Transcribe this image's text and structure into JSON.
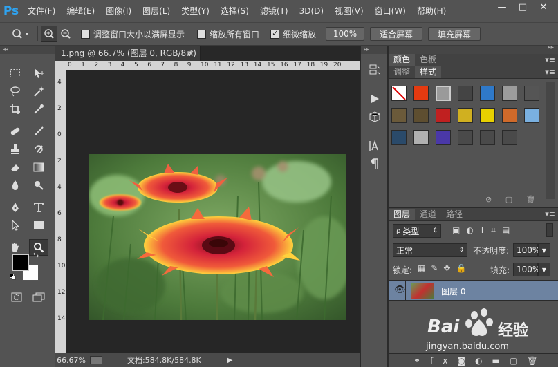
{
  "app": {
    "logo": "Ps"
  },
  "menu": [
    "文件(F)",
    "编辑(E)",
    "图像(I)",
    "图层(L)",
    "类型(Y)",
    "选择(S)",
    "滤镜(T)",
    "3D(D)",
    "视图(V)",
    "窗口(W)",
    "帮助(H)"
  ],
  "window_controls": {
    "minimize": "—",
    "maximize": "□",
    "close": "✕"
  },
  "options": {
    "resize_windows": {
      "label": "调整窗口大小以满屏显示",
      "checked": false
    },
    "zoom_all": {
      "label": "缩放所有窗口",
      "checked": false
    },
    "scrubby_zoom": {
      "label": "细微缩放",
      "checked": true
    },
    "btn_100": "100%",
    "btn_fit": "适合屏幕",
    "btn_fill": "填充屏幕"
  },
  "document": {
    "tab_title": "1.png @ 66.7% (图层 0, RGB/8#) *",
    "ruler_top": [
      "0",
      "1",
      "2",
      "3",
      "4",
      "5",
      "6",
      "7",
      "8",
      "9",
      "10",
      "11",
      "12",
      "13",
      "14",
      "15",
      "16",
      "17",
      "18",
      "19",
      "20"
    ],
    "ruler_left": [
      "4",
      "2",
      "0",
      "2",
      "4",
      "6",
      "8",
      "10",
      "12",
      "14"
    ],
    "zoom": "66.67%",
    "doc_size": "文档:584.8K/584.8K"
  },
  "panels": {
    "color_tabs": [
      "颜色",
      "色板"
    ],
    "style_tabs": [
      "调整",
      "样式"
    ],
    "layer_tabs": [
      "图层",
      "通道",
      "路径"
    ],
    "filter_kind": "类型",
    "blend_mode": "正常",
    "opacity_label": "不透明度:",
    "opacity_value": "100%",
    "lock_label": "锁定:",
    "fill_label": "填充:",
    "fill_value": "100%",
    "layer_name": "图层 0"
  },
  "colors": {
    "style_swatches": [
      "#ffffff",
      "#e53a10",
      "#9a9a9a",
      "#444444",
      "#2f79c9",
      "#9c9c9c",
      "#555555",
      "#6b5a3a",
      "#5e4e30",
      "#c02020",
      "#d0b020",
      "#e8d000",
      "#d06a2a",
      "#7ab0e0",
      "#2a4a6a",
      "#b0b0b0",
      "#4a38a8",
      "#4a4a4a",
      "#4a4a4a",
      "#4a4a4a"
    ]
  },
  "watermark": {
    "brand": "Bai",
    "brand2": "经验",
    "url": "jingyan.baidu.com"
  }
}
